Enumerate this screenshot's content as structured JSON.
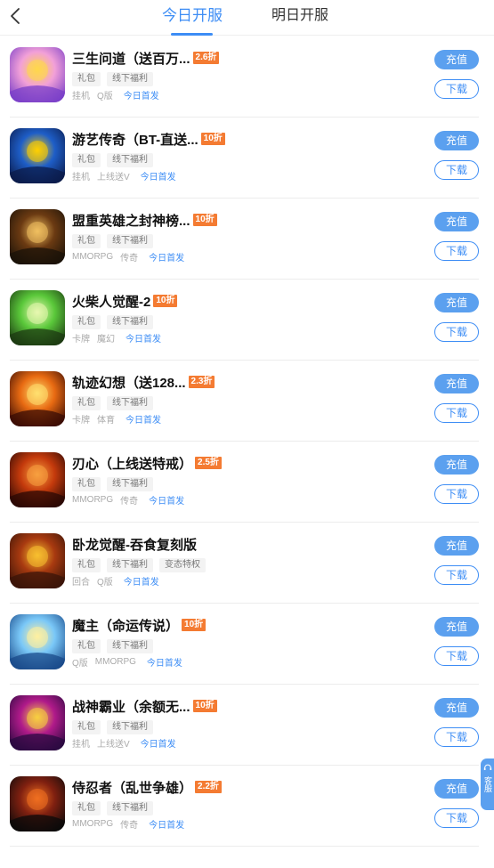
{
  "header": {
    "tabs": [
      {
        "label": "今日开服"
      },
      {
        "label": "明日开服"
      }
    ]
  },
  "buttons": {
    "charge": "充值",
    "download": "下载"
  },
  "games": [
    {
      "title": "三生问道（送百万...",
      "discount": "2.6折",
      "tags": [
        "礼包",
        "线下福利"
      ],
      "meta": [
        "挂机",
        "Q版"
      ],
      "first": "今日首发"
    },
    {
      "title": "游艺传奇（BT-直送...",
      "discount": "10折",
      "tags": [
        "礼包",
        "线下福利"
      ],
      "meta": [
        "挂机",
        "上线送V"
      ],
      "first": "今日首发"
    },
    {
      "title": "盟重英雄之封神榜...",
      "discount": "10折",
      "tags": [
        "礼包",
        "线下福利"
      ],
      "meta": [
        "MMORPG",
        "传奇"
      ],
      "first": "今日首发"
    },
    {
      "title": "火柴人觉醒-2",
      "discount": "10折",
      "tags": [
        "礼包",
        "线下福利"
      ],
      "meta": [
        "卡牌",
        "魔幻"
      ],
      "first": "今日首发"
    },
    {
      "title": "轨迹幻想（送128...",
      "discount": "2.3折",
      "tags": [
        "礼包",
        "线下福利"
      ],
      "meta": [
        "卡牌",
        "体育"
      ],
      "first": "今日首发"
    },
    {
      "title": "刃心（上线送特戒）",
      "discount": "2.5折",
      "tags": [
        "礼包",
        "线下福利"
      ],
      "meta": [
        "MMORPG",
        "传奇"
      ],
      "first": "今日首发"
    },
    {
      "title": "卧龙觉醒-吞食复刻版",
      "discount": "",
      "tags": [
        "礼包",
        "线下福利",
        "变态特权"
      ],
      "meta": [
        "回合",
        "Q版"
      ],
      "first": "今日首发"
    },
    {
      "title": "魔主（命运传说）",
      "discount": "10折",
      "tags": [
        "礼包",
        "线下福利"
      ],
      "meta": [
        "Q版",
        "MMORPG"
      ],
      "first": "今日首发"
    },
    {
      "title": "战神霸业（余额无...",
      "discount": "10折",
      "tags": [
        "礼包",
        "线下福利"
      ],
      "meta": [
        "挂机",
        "上线送V"
      ],
      "first": "今日首发"
    },
    {
      "title": "侍忍者（乱世争雄）",
      "discount": "2.2折",
      "tags": [
        "礼包",
        "线下福利"
      ],
      "meta": [
        "MMORPG",
        "传奇"
      ],
      "first": "今日首发"
    }
  ],
  "float_service": {
    "label": "客服"
  },
  "icons": [
    "back-arrow-icon",
    "game-app-icon",
    "headset-icon"
  ],
  "colors": {
    "accent": "#3d8df5",
    "charge_bg": "#5ba0ef",
    "discount": "#f47b32"
  }
}
